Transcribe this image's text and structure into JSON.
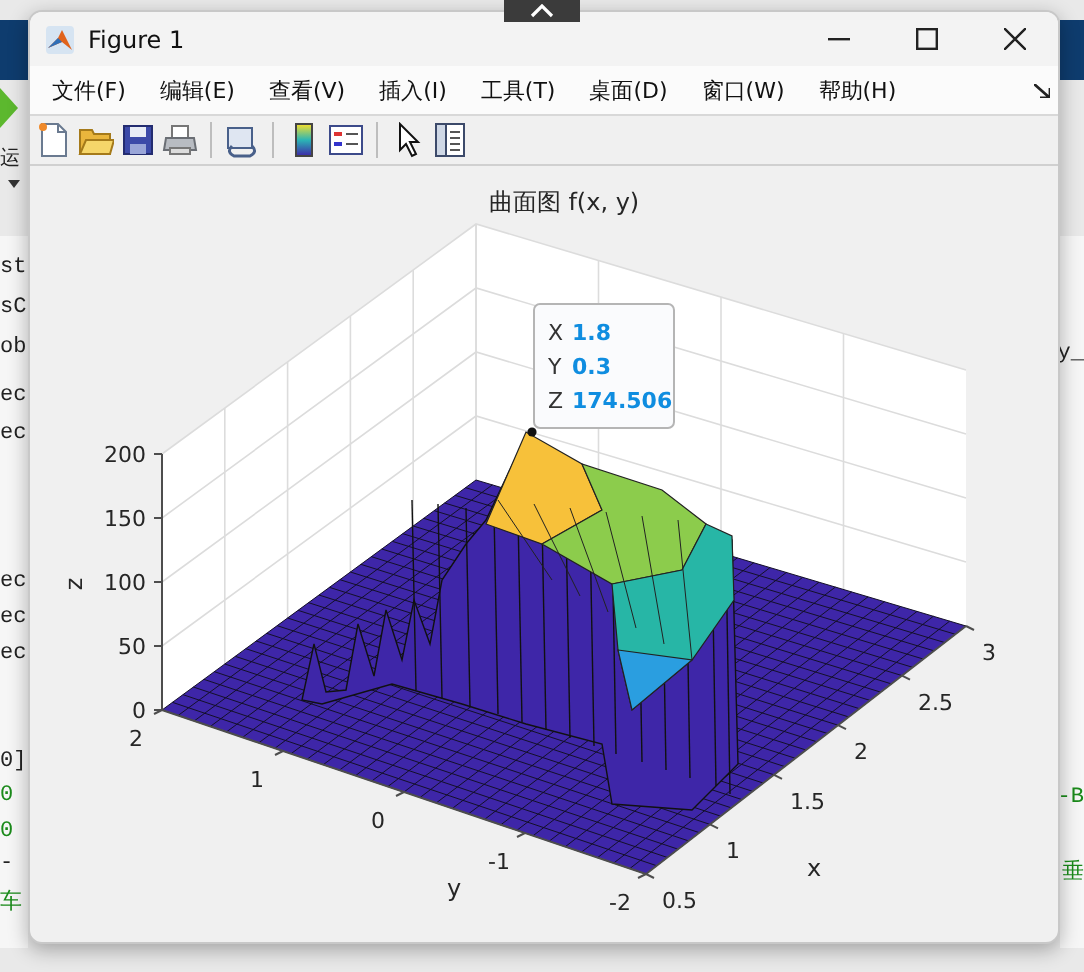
{
  "desktop": {
    "left_fragments": [
      {
        "text": "运",
        "kind": "label"
      },
      {
        "text": "st",
        "kind": "code"
      },
      {
        "text": "sC",
        "kind": "code"
      },
      {
        "text": "ob",
        "kind": "code"
      },
      {
        "text": "ec",
        "kind": "code"
      },
      {
        "text": "ec",
        "kind": "code"
      },
      {
        "text": "ec",
        "kind": "code"
      },
      {
        "text": "ec",
        "kind": "code"
      },
      {
        "text": "ec",
        "kind": "code"
      },
      {
        "text": "0]",
        "kind": "code"
      },
      {
        "text": "0",
        "kind": "comment"
      },
      {
        "text": "0",
        "kind": "comment"
      },
      {
        "text": "-",
        "kind": "code"
      },
      {
        "text": "车",
        "kind": "comment"
      }
    ],
    "right_fragments": [
      {
        "text": "y_",
        "kind": "code"
      },
      {
        "text": "-B",
        "kind": "comment"
      },
      {
        "text": "垂",
        "kind": "comment"
      }
    ]
  },
  "window": {
    "title": "Figure 1"
  },
  "menu": [
    "文件(F)",
    "编辑(E)",
    "查看(V)",
    "插入(I)",
    "工具(T)",
    "桌面(D)",
    "窗口(W)",
    "帮助(H)"
  ],
  "toolbar": [
    {
      "kind": "new"
    },
    {
      "kind": "open"
    },
    {
      "kind": "save"
    },
    {
      "kind": "print"
    },
    {
      "kind": "sep"
    },
    {
      "kind": "link"
    },
    {
      "kind": "sep"
    },
    {
      "kind": "colorbar"
    },
    {
      "kind": "legend"
    },
    {
      "kind": "sep"
    },
    {
      "kind": "pointer"
    },
    {
      "kind": "inspector"
    }
  ],
  "plot": {
    "title": "曲面图 f(x, y)",
    "xlabel": "x",
    "ylabel": "y",
    "zlabel": "z",
    "xticks": [
      "0.5",
      "1",
      "1.5",
      "2",
      "2.5",
      "3"
    ],
    "yticks": [
      "2",
      "1",
      "0",
      "-1",
      "-2"
    ],
    "zticks": [
      "200",
      "150",
      "100",
      "50",
      "0"
    ],
    "datatip": [
      {
        "axis": "X",
        "value": "1.8"
      },
      {
        "axis": "Y",
        "value": "0.3"
      },
      {
        "axis": "Z",
        "value": "174.506"
      }
    ]
  }
}
